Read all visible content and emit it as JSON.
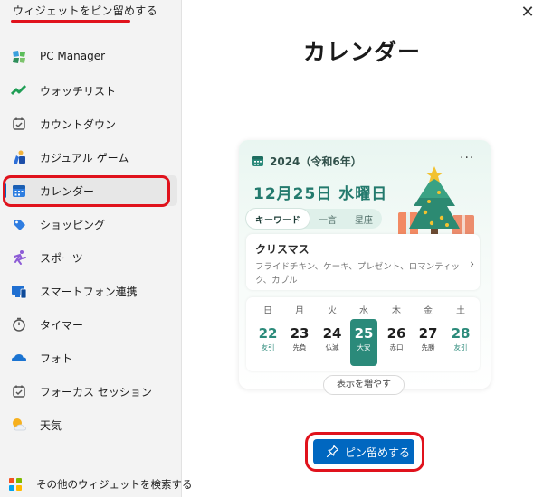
{
  "pane": {
    "title": "ウィジェットをピン留めする"
  },
  "sidebar": {
    "items": [
      {
        "label": "PC Manager",
        "icon": "pc-manager-icon"
      },
      {
        "label": "ウォッチリスト",
        "icon": "watchlist-icon"
      },
      {
        "label": "カウントダウン",
        "icon": "countdown-icon"
      },
      {
        "label": "カジュアル ゲーム",
        "icon": "casual-games-icon"
      },
      {
        "label": "カレンダー",
        "icon": "calendar-icon",
        "selected": true
      },
      {
        "label": "ショッピング",
        "icon": "shopping-icon"
      },
      {
        "label": "スポーツ",
        "icon": "sports-icon"
      },
      {
        "label": "スマートフォン連携",
        "icon": "phone-link-icon"
      },
      {
        "label": "タイマー",
        "icon": "timer-icon"
      },
      {
        "label": "フォト",
        "icon": "photos-icon"
      },
      {
        "label": "フォーカス セッション",
        "icon": "focus-session-icon"
      },
      {
        "label": "天気",
        "icon": "weather-icon"
      }
    ],
    "search_label": "その他のウィジェットを検索する"
  },
  "close_glyph": "✕",
  "widget": {
    "name": "カレンダー",
    "header": "2024（令和6年）",
    "more": "···",
    "date": "12月25日 水曜日",
    "tabs": [
      "キーワード",
      "一言",
      "星座"
    ],
    "event": {
      "title": "クリスマス",
      "desc": "フライドチキン、ケーキ、プレゼント、ロマンティック、カプル",
      "chevron": "›"
    },
    "weekdays": [
      "日",
      "月",
      "火",
      "水",
      "木",
      "金",
      "土"
    ],
    "days": [
      {
        "n": "22",
        "r": "友引"
      },
      {
        "n": "23",
        "r": "先負"
      },
      {
        "n": "24",
        "r": "仏滅"
      },
      {
        "n": "25",
        "r": "大安"
      },
      {
        "n": "26",
        "r": "赤口"
      },
      {
        "n": "27",
        "r": "先勝"
      },
      {
        "n": "28",
        "r": "友引"
      }
    ],
    "show_more": "表示を増やす"
  },
  "pin_button": {
    "label": "ピン留めする"
  },
  "colors": {
    "accent": "#0067c0",
    "highlight": "#e0121c",
    "calendar_green": "#2b8a7a"
  }
}
